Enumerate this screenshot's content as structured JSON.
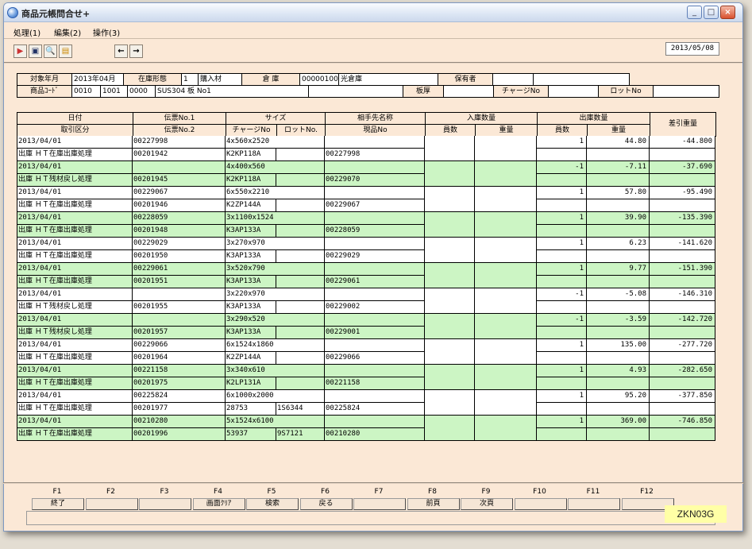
{
  "window": {
    "title": "商品元帳問合せ+",
    "screen_id": "ZKN03G"
  },
  "menu": [
    "処理(1)",
    "編集(2)",
    "操作(3)"
  ],
  "toolbar": {
    "date": "2013/05/08"
  },
  "info": {
    "label_month": "対象年月",
    "month": "2013年04月",
    "label_stock_type": "在庫形態",
    "stock_type_code": "1",
    "stock_type": "購入材",
    "label_warehouse": "倉 庫",
    "warehouse_code": "00000100",
    "warehouse": "光倉庫",
    "label_holder": "保有者",
    "label_product_code": "商品ｺｰﾄﾞ",
    "product_code_1": "0010",
    "product_code_2": "1001",
    "product_code_3": "0000",
    "product_name": "SUS304 板 No1",
    "label_thickness": "板厚",
    "label_charge": "チャージNo",
    "label_lot": "ロットNo"
  },
  "grid": {
    "headers": {
      "date": "日付",
      "txn_type": "取引区分",
      "slip1": "伝票No.1",
      "slip2": "伝票No.2",
      "size": "サイズ",
      "charge": "チャージNo",
      "lot": "ロットNo.",
      "partner": "相手先名称",
      "genpin": "現品No",
      "in_qty": "入庫数量",
      "in_count": "員数",
      "in_weight": "重量",
      "out_qty": "出庫数量",
      "out_count": "員数",
      "out_weight": "重量",
      "balance": "差引重量"
    },
    "rows": [
      {
        "date": "2013/04/01",
        "type": "出庫 ＨＴ在庫出庫処理",
        "slip1": "00227998",
        "slip2": "00201942",
        "size": "4x560x2520",
        "charge": "K2KP118A",
        "lot": "",
        "genpin": "00227998",
        "out_count": "1",
        "out_weight": "44.80",
        "balance": "-44.800"
      },
      {
        "date": "2013/04/01",
        "type": "出庫 ＨＴ残材戻し処理",
        "slip1": "",
        "slip2": "00201945",
        "size": "4x400x560",
        "charge": "K2KP118A",
        "lot": "",
        "genpin": "00229070",
        "out_count": "-1",
        "out_weight": "-7.11",
        "balance": "-37.690"
      },
      {
        "date": "2013/04/01",
        "type": "出庫 ＨＴ在庫出庫処理",
        "slip1": "00229067",
        "slip2": "00201946",
        "size": "6x550x2210",
        "charge": "K2ZP144A",
        "lot": "",
        "genpin": "00229067",
        "out_count": "1",
        "out_weight": "57.80",
        "balance": "-95.490"
      },
      {
        "date": "2013/04/01",
        "type": "出庫 ＨＴ在庫出庫処理",
        "slip1": "00228059",
        "slip2": "00201948",
        "size": "3x1100x1524",
        "charge": "K3AP133A",
        "lot": "",
        "genpin": "00228059",
        "out_count": "1",
        "out_weight": "39.90",
        "balance": "-135.390"
      },
      {
        "date": "2013/04/01",
        "type": "出庫 ＨＴ在庫出庫処理",
        "slip1": "00229029",
        "slip2": "00201950",
        "size": "3x270x970",
        "charge": "K3AP133A",
        "lot": "",
        "genpin": "00229029",
        "out_count": "1",
        "out_weight": "6.23",
        "balance": "-141.620"
      },
      {
        "date": "2013/04/01",
        "type": "出庫 ＨＴ在庫出庫処理",
        "slip1": "00229061",
        "slip2": "00201951",
        "size": "3x520x790",
        "charge": "K3AP133A",
        "lot": "",
        "genpin": "00229061",
        "out_count": "1",
        "out_weight": "9.77",
        "balance": "-151.390"
      },
      {
        "date": "2013/04/01",
        "type": "出庫 ＨＴ残材戻し処理",
        "slip1": "",
        "slip2": "00201955",
        "size": "3x220x970",
        "charge": "K3AP133A",
        "lot": "",
        "genpin": "00229002",
        "out_count": "-1",
        "out_weight": "-5.08",
        "balance": "-146.310"
      },
      {
        "date": "2013/04/01",
        "type": "出庫 ＨＴ残材戻し処理",
        "slip1": "",
        "slip2": "00201957",
        "size": "3x290x520",
        "charge": "K3AP133A",
        "lot": "",
        "genpin": "00229001",
        "out_count": "-1",
        "out_weight": "-3.59",
        "balance": "-142.720"
      },
      {
        "date": "2013/04/01",
        "type": "出庫 ＨＴ在庫出庫処理",
        "slip1": "00229066",
        "slip2": "00201964",
        "size": "6x1524x1860",
        "charge": "K2ZP144A",
        "lot": "",
        "genpin": "00229066",
        "out_count": "1",
        "out_weight": "135.00",
        "balance": "-277.720"
      },
      {
        "date": "2013/04/01",
        "type": "出庫 ＨＴ在庫出庫処理",
        "slip1": "00221158",
        "slip2": "00201975",
        "size": "3x340x610",
        "charge": "K2LP131A",
        "lot": "",
        "genpin": "00221158",
        "out_count": "1",
        "out_weight": "4.93",
        "balance": "-282.650"
      },
      {
        "date": "2013/04/01",
        "type": "出庫 ＨＴ在庫出庫処理",
        "slip1": "00225824",
        "slip2": "00201977",
        "size": "6x1000x2000",
        "charge": "28753",
        "lot": "1S6344",
        "genpin": "00225824",
        "out_count": "1",
        "out_weight": "95.20",
        "balance": "-377.850"
      },
      {
        "date": "2013/04/01",
        "type": "出庫 ＨＴ在庫出庫処理",
        "slip1": "00210280",
        "slip2": "00201996",
        "size": "5x1524x6100",
        "charge": "53937",
        "lot": "9S7121",
        "genpin": "00210280",
        "out_count": "1",
        "out_weight": "369.00",
        "balance": "-746.850"
      }
    ]
  },
  "fkeys": [
    {
      "key": "F1",
      "label": "終了"
    },
    {
      "key": "F2",
      "label": ""
    },
    {
      "key": "F3",
      "label": ""
    },
    {
      "key": "F4",
      "label": "画面ｸﾘｱ"
    },
    {
      "key": "F5",
      "label": "検索"
    },
    {
      "key": "F6",
      "label": "戻る"
    },
    {
      "key": "F7",
      "label": ""
    },
    {
      "key": "F8",
      "label": "前頁"
    },
    {
      "key": "F9",
      "label": "次頁"
    },
    {
      "key": "F10",
      "label": ""
    },
    {
      "key": "F11",
      "label": ""
    },
    {
      "key": "F12",
      "label": ""
    }
  ],
  "colors": {
    "background": "#fbe8d6",
    "row_alt": "#ccf5c4",
    "screen_id_bg": "#ffffa6"
  },
  "icons": [
    "exit-icon",
    "screen-icon",
    "search-icon",
    "layout-icon",
    "arrow-left-icon",
    "arrow-right-icon"
  ]
}
